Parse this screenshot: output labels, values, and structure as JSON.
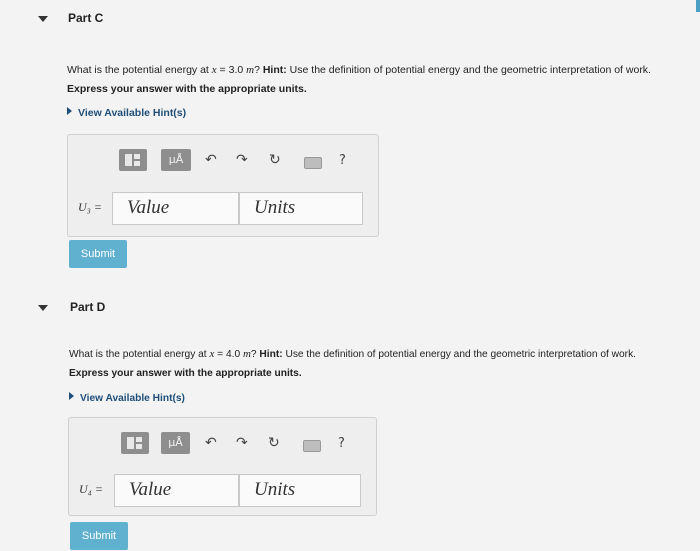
{
  "partC": {
    "title": "Part C",
    "question_prefix": "What is the potential energy at ",
    "question_var": "x",
    "question_value": " = 3.0 ",
    "question_unit": "m",
    "question_mark": "?",
    "hint_label": "Hint:",
    "hint_text": " Use the definition of potential energy and the geometric interpretation of work.",
    "express": "Express your answer with the appropriate units.",
    "view_hints": "View Available Hint(s)",
    "mu_label": "μÅ",
    "help": "?",
    "variable": "U₃ =",
    "value_placeholder": "Value",
    "units_placeholder": "Units",
    "submit": "Submit"
  },
  "partD": {
    "title": "Part D",
    "question_prefix": "What is the potential energy at ",
    "question_var": "x",
    "question_value": " = 4.0 ",
    "question_unit": "m",
    "question_mark": "?",
    "hint_label": "Hint:",
    "hint_text": " Use the definition of potential energy and the geometric interpretation of work.",
    "express": "Express your answer with the appropriate units.",
    "view_hints": "View Available Hint(s)",
    "mu_label": "μÅ",
    "help": "?",
    "variable": "U₄ =",
    "value_placeholder": "Value",
    "units_placeholder": "Units",
    "submit": "Submit"
  },
  "icons": {
    "undo": "↶",
    "redo": "↷",
    "reset": "↻"
  },
  "colors": {
    "submit": "#5fb1cf",
    "hint_link": "#1f4e79",
    "background": "#f3f3f3"
  }
}
